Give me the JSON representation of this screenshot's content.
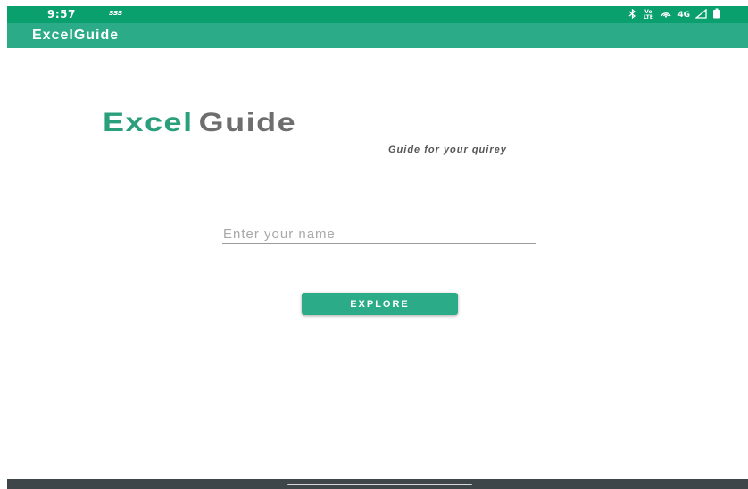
{
  "status_bar": {
    "time": "9:57",
    "notification_text": "sss",
    "network_label": "4G",
    "volte_label": "Vo LTE",
    "icons": [
      "bluetooth-icon",
      "volte-icon",
      "hotspot-icon",
      "signal-icon",
      "battery-icon"
    ],
    "color": "#0aa06e"
  },
  "app_bar": {
    "title": "ExcelGuide",
    "color": "#2bab87"
  },
  "logo": {
    "excel": "Excel",
    "guide": "Guide",
    "excel_color": "#2a9f7b",
    "guide_color": "#6e6e6e"
  },
  "tagline": "Guide for your quirey",
  "name_input": {
    "placeholder": "Enter your name",
    "value": ""
  },
  "explore_button": {
    "label": "EXPLORE",
    "color": "#2bab87"
  },
  "nav_bar": {
    "color": "#3f4649"
  }
}
